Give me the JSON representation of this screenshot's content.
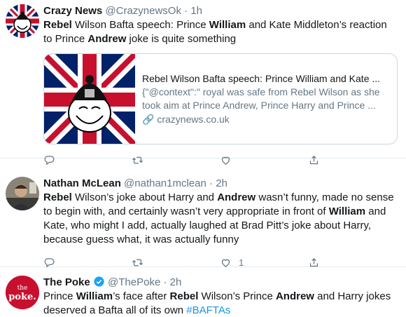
{
  "tweets": [
    {
      "name": "Crazy News",
      "handle": "@CrazynewsOk",
      "time": "1h",
      "text": [
        {
          "t": "Rebel",
          "b": true
        },
        {
          "t": " Wilson Bafta speech: Prince "
        },
        {
          "t": "William",
          "b": true
        },
        {
          "t": " and Kate Middleton’s reaction to Prince "
        },
        {
          "t": "Andrew",
          "b": true
        },
        {
          "t": " joke is quite something"
        }
      ],
      "card": {
        "title": "Rebel Wilson Bafta speech: Prince William and Kate ...",
        "description": "{\"@context\":\" royal was safe from Rebel Wilson as she took aim at Prince Andrew, Prince Harry and Prince ...",
        "domain": "crazynews.co.uk"
      },
      "actions": {
        "reply": "",
        "retweet": "",
        "like": "",
        "share": ""
      }
    },
    {
      "name": "Nathan McLean",
      "handle": "@nathan1mclean",
      "time": "2h",
      "text": [
        {
          "t": "Rebel",
          "b": true
        },
        {
          "t": " Wilson’s joke about Harry and "
        },
        {
          "t": "Andrew",
          "b": true
        },
        {
          "t": " wasn’t funny, made no sense to begin with, and certainly wasn’t very appropriate in front of "
        },
        {
          "t": "William",
          "b": true
        },
        {
          "t": " and Kate, who might I add, actually laughed at Brad Pitt’s joke about Harry, because guess what, it was actually funny"
        }
      ],
      "actions": {
        "reply": "",
        "retweet": "",
        "like": "1",
        "share": ""
      }
    },
    {
      "name": "The Poke",
      "handle": "@ThePoke",
      "time": "2h",
      "verified": true,
      "text": [
        {
          "t": "Prince "
        },
        {
          "t": "William",
          "b": true
        },
        {
          "t": "’s face after "
        },
        {
          "t": "Rebel",
          "b": true
        },
        {
          "t": " Wilson’s Prince "
        },
        {
          "t": "Andrew",
          "b": true
        },
        {
          "t": " and Harry jokes deserved a Bafta all of its own "
        },
        {
          "t": "#BAFTAs",
          "h": true
        }
      ],
      "logo_text": "the poke."
    }
  ],
  "separator": "·",
  "colors": {
    "text": "#14171a",
    "muted": "#657786",
    "link": "#1b95e0",
    "border": "#e6ecf0",
    "poke_red": "#c8102e"
  }
}
